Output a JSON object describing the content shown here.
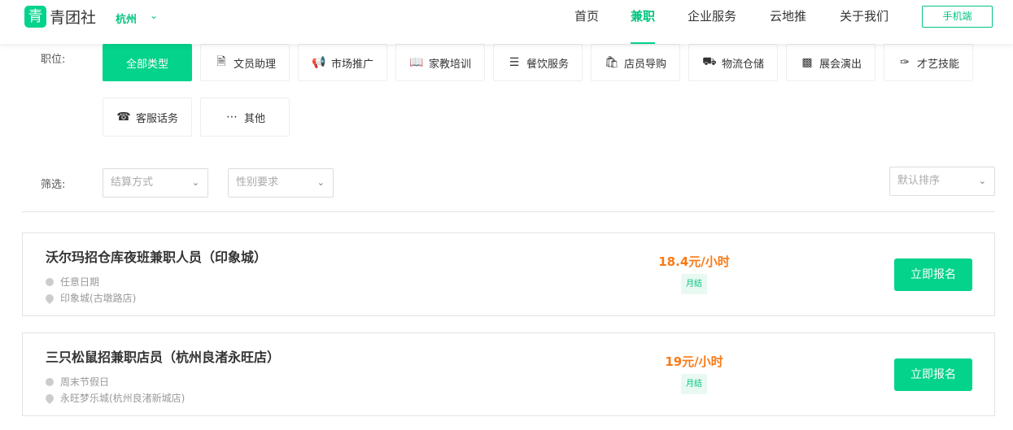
{
  "header": {
    "logo_text": "青团社",
    "logo_mark": "青",
    "city": "杭州",
    "nav": [
      "首页",
      "兼职",
      "企业服务",
      "云地推",
      "关于我们"
    ],
    "active_nav": "兼职",
    "mobile_button": "手机端"
  },
  "categories": {
    "label": "职位:",
    "items": [
      {
        "label": "全部类型",
        "icon": ""
      },
      {
        "label": "文员助理",
        "icon": "document-icon"
      },
      {
        "label": "市场推广",
        "icon": "megaphone-icon"
      },
      {
        "label": "家教培训",
        "icon": "book-icon"
      },
      {
        "label": "餐饮服务",
        "icon": "food-icon"
      },
      {
        "label": "店员导购",
        "icon": "shopping-bag-icon"
      },
      {
        "label": "物流仓储",
        "icon": "truck-icon"
      },
      {
        "label": "展会演出",
        "icon": "ticket-icon"
      },
      {
        "label": "才艺技能",
        "icon": "brush-icon"
      },
      {
        "label": "客服话务",
        "icon": "headset-icon"
      },
      {
        "label": "其他",
        "icon": "more-icon"
      }
    ]
  },
  "filters": {
    "label": "筛选:",
    "settlement_placeholder": "结算方式",
    "gender_placeholder": "性别要求",
    "sort_placeholder": "默认排序"
  },
  "jobs": [
    {
      "title": "沃尔玛招仓库夜班兼职人员（印象城）",
      "date": "任意日期",
      "location": "印象城(古墩路店)",
      "price": "18.4元/小时",
      "settlement": "月结",
      "apply": "立即报名"
    },
    {
      "title": "三只松鼠招兼职店员（杭州良渚永旺店）",
      "date": "周末节假日",
      "location": "永旺梦乐城(杭州良渚新城店)",
      "price": "19元/小时",
      "settlement": "月结",
      "apply": "立即报名"
    }
  ],
  "colors": {
    "accent": "#03d38b",
    "price": "#f97a16"
  }
}
